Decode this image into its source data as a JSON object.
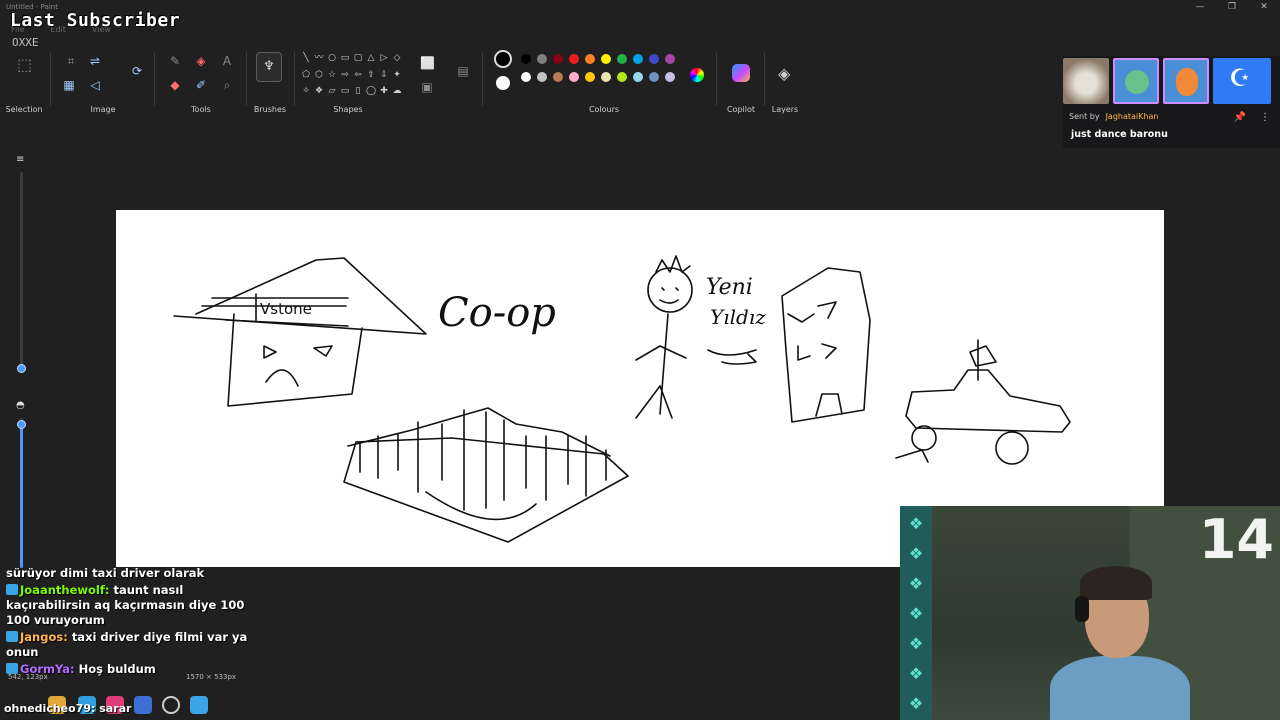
{
  "window": {
    "title": "Untitled - Paint",
    "controls": [
      "—",
      "❐",
      "✕"
    ]
  },
  "menu": [
    "File",
    "Edit",
    "View"
  ],
  "overlay": {
    "last_subscriber_label": "Last Subscriber",
    "last_subscriber_name": "OXXE"
  },
  "ribbon": {
    "groups": {
      "selection": "Selection",
      "image": "Image",
      "tools": "Tools",
      "brushes": "Brushes",
      "shapes": "Shapes",
      "colours": "Colours",
      "copilot": "Copilot",
      "layers": "Layers"
    },
    "shape_glyphs": [
      "╲",
      "〰",
      "○",
      "▭",
      "▢",
      "△",
      "▷",
      "◇",
      "⬠",
      "⬡",
      "☆",
      "⇨",
      "⇦",
      "⇧",
      "⇩",
      "✦",
      "✧",
      "❖",
      "▱",
      "▭",
      "▯",
      "◯",
      "✚",
      "☁"
    ],
    "palette_colors": [
      "#000000",
      "#7f7f7f",
      "#880015",
      "#ed1c24",
      "#ff7f27",
      "#fff200",
      "#22b14c",
      "#00a2e8",
      "#3f48cc",
      "#a349a4",
      "#ffffff",
      "#c3c3c3",
      "#b97a57",
      "#ffaec9",
      "#ffc90e",
      "#efe4b0",
      "#b5e61d",
      "#99d9ea",
      "#7092be",
      "#c8bfe7"
    ]
  },
  "status": {
    "position": "542, 123px",
    "canvas_size": "1570 × 533px"
  },
  "chat": [
    {
      "user": "",
      "user_color": "#ffffff",
      "text": "sürüyor dimi taxi driver olarak"
    },
    {
      "user": "Joaanthewolf",
      "user_color": "#7cfc00",
      "text": "taunt nasıl kaçırabilirsin aq kaçırmasın diye 100 100 vuruyorum"
    },
    {
      "user": "Jangos",
      "user_color": "#ffb547",
      "text": "taxi driver diye filmi var ya onun"
    },
    {
      "user": "GormYa",
      "user_color": "#b26cff",
      "text": "Hoş buldum"
    }
  ],
  "taskbar_text": "ohnedicheo79: sarar",
  "alert": {
    "sent_by_label": "Sent by",
    "sender": "JaghataiKhan",
    "message": "just dance baronu"
  },
  "webcam": {
    "counter": "14"
  },
  "canvas_text": {
    "house_label": "Vstone",
    "coop": "Co-op",
    "yeni": "Yeni",
    "yildiz": "Yıldız"
  }
}
